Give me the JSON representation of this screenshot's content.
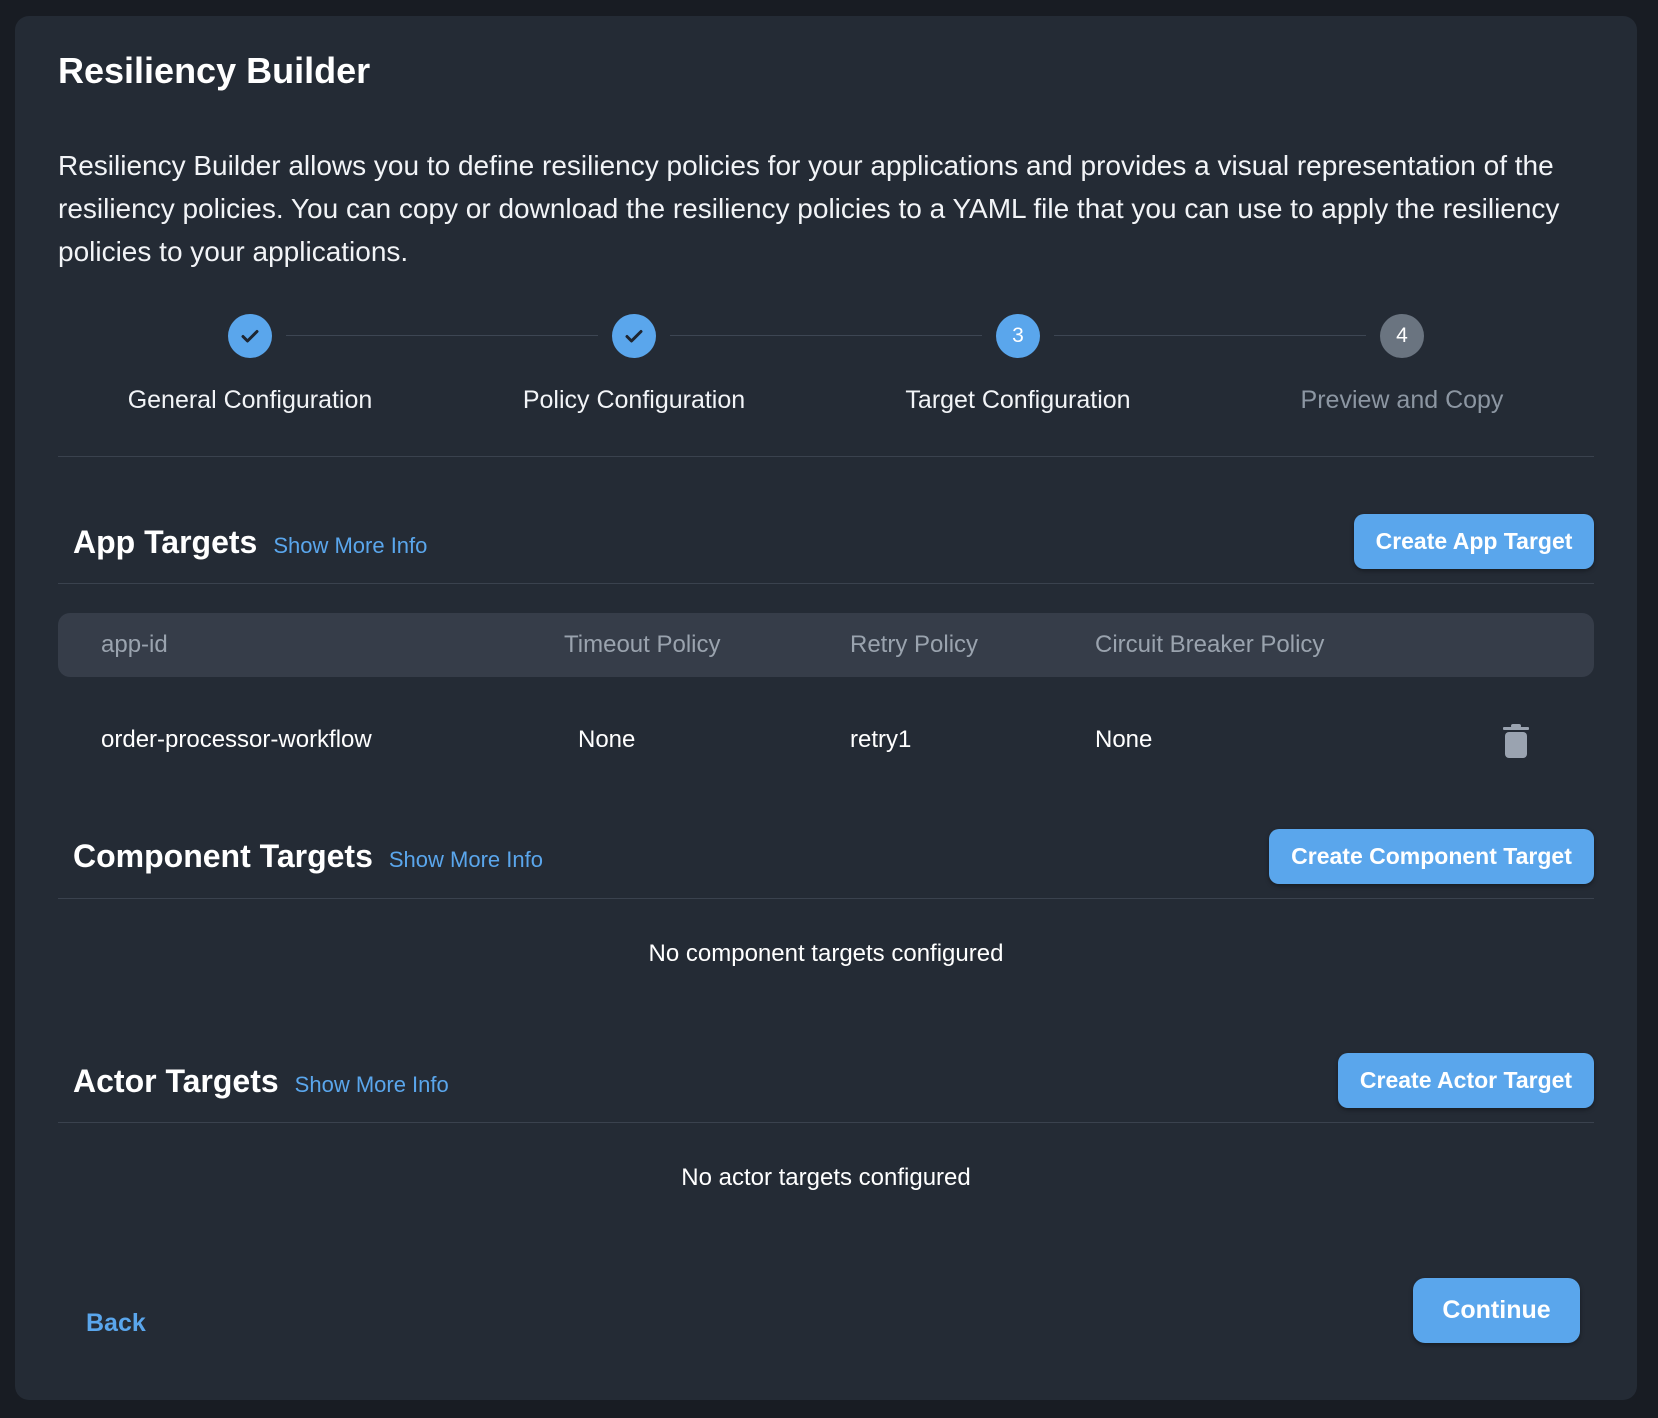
{
  "page": {
    "title": "Resiliency Builder",
    "description": "Resiliency Builder allows you to define resiliency policies for your applications and provides a visual representation of the resiliency policies. You can copy or download the resiliency policies to a YAML file that you can use to apply the resiliency policies to your applications."
  },
  "stepper": {
    "steps": [
      {
        "label": "General Configuration",
        "status": "completed",
        "marker": "✓"
      },
      {
        "label": "Policy Configuration",
        "status": "completed",
        "marker": "✓"
      },
      {
        "label": "Target Configuration",
        "status": "active",
        "marker": "3"
      },
      {
        "label": "Preview and Copy",
        "status": "pending",
        "marker": "4"
      }
    ]
  },
  "app_targets": {
    "title": "App Targets",
    "more_info": "Show More Info",
    "create_button": "Create App Target",
    "columns": [
      "app-id",
      "Timeout Policy",
      "Retry Policy",
      "Circuit Breaker Policy"
    ],
    "rows": [
      {
        "app_id": "order-processor-workflow",
        "timeout": "None",
        "retry": "retry1",
        "circuit_breaker": "None",
        "action_icon": "trash-icon"
      }
    ]
  },
  "component_targets": {
    "title": "Component Targets",
    "more_info": "Show More Info",
    "create_button": "Create Component Target",
    "empty_message": "No component targets configured"
  },
  "actor_targets": {
    "title": "Actor Targets",
    "more_info": "Show More Info",
    "create_button": "Create Actor Target",
    "empty_message": "No actor targets configured"
  },
  "footer": {
    "back_label": "Back",
    "continue_label": "Continue"
  },
  "colors": {
    "accent": "#5aa6ec",
    "background": "#181c23",
    "card": "#242b35",
    "table_header": "#363d49",
    "pending_step": "#6a7480"
  }
}
